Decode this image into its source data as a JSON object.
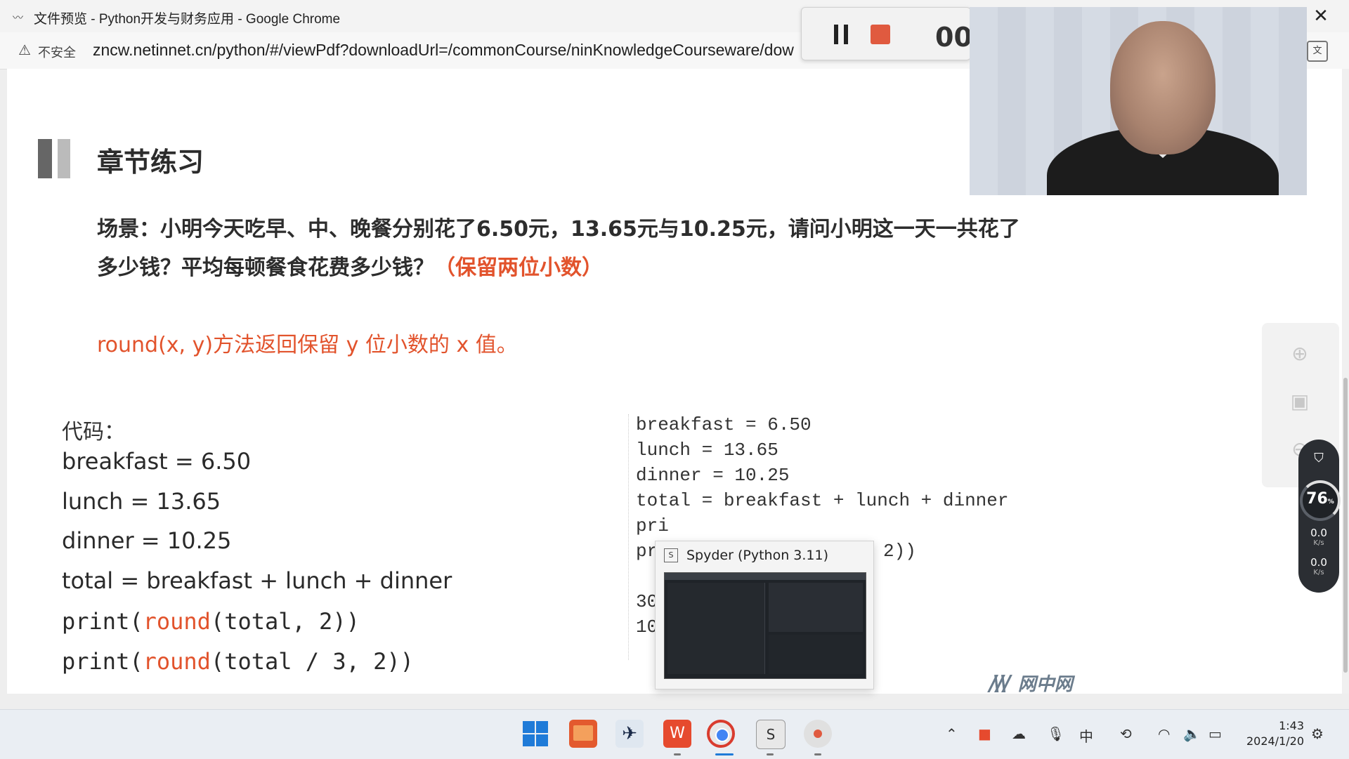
{
  "window": {
    "title": "文件预览 - Python开发与财务应用 - Google Chrome",
    "close_glyph": "✕"
  },
  "address_bar": {
    "security_label": "不安全",
    "url": "zncw.netinnet.cn/python/#/viewPdf?downloadUrl=/commonCourse/ninKnowledgeCourseware/dow"
  },
  "recorder": {
    "timer": "00"
  },
  "slide": {
    "section_title": "章节练习",
    "scenario_line1": "场景：小明今天吃早、中、晚餐分别花了6.50元，13.65元与10.25元，请问小明这一天一共花了",
    "scenario_line2": "多少钱？平均每顿餐食花费多少钱？",
    "scenario_note": "（保留两位小数）",
    "hint": "round(x, y)方法返回保留 y 位小数的 x 值。",
    "code_label": "代码：",
    "code_lines": [
      "breakfast = 6.50",
      "lunch = 13.65",
      "dinner = 10.25",
      "total = breakfast + lunch + dinner"
    ],
    "print1": {
      "prefix": "print(",
      "fn": "round",
      "args": "(total, 2)",
      "close": ")"
    },
    "print2": {
      "prefix": "print(",
      "fn": "round",
      "args": "(total / 3, 2)",
      "close": ")"
    },
    "right_code": [
      "breakfast = 6.50",
      "lunch = 13.65",
      "dinner = 10.25",
      "total = breakfast + lunch + dinner",
      "pri",
      "pr"
    ],
    "right_code_tail": "2))",
    "outputs": [
      "30",
      "10"
    ]
  },
  "spyder_preview": {
    "title": "Spyder (Python 3.11)"
  },
  "net_meter": {
    "percent": "76",
    "percent_unit": "%",
    "upload": "0.0",
    "upload_unit": "K/s",
    "download": "0.0",
    "download_unit": "K/s"
  },
  "watermark": {
    "text": "网中网"
  },
  "taskbar": {
    "clock_time": "1:43",
    "clock_date": "2024/1/20"
  },
  "icons": {
    "app": "trend-icon",
    "warning": "warning-icon",
    "translate": "translate-icon",
    "zoom_in": "zoom-in-icon",
    "fit": "fit-page-icon",
    "shield": "shield-icon"
  },
  "colors": {
    "accent_red": "#e2532c",
    "recorder_stop": "#e05a3f"
  }
}
